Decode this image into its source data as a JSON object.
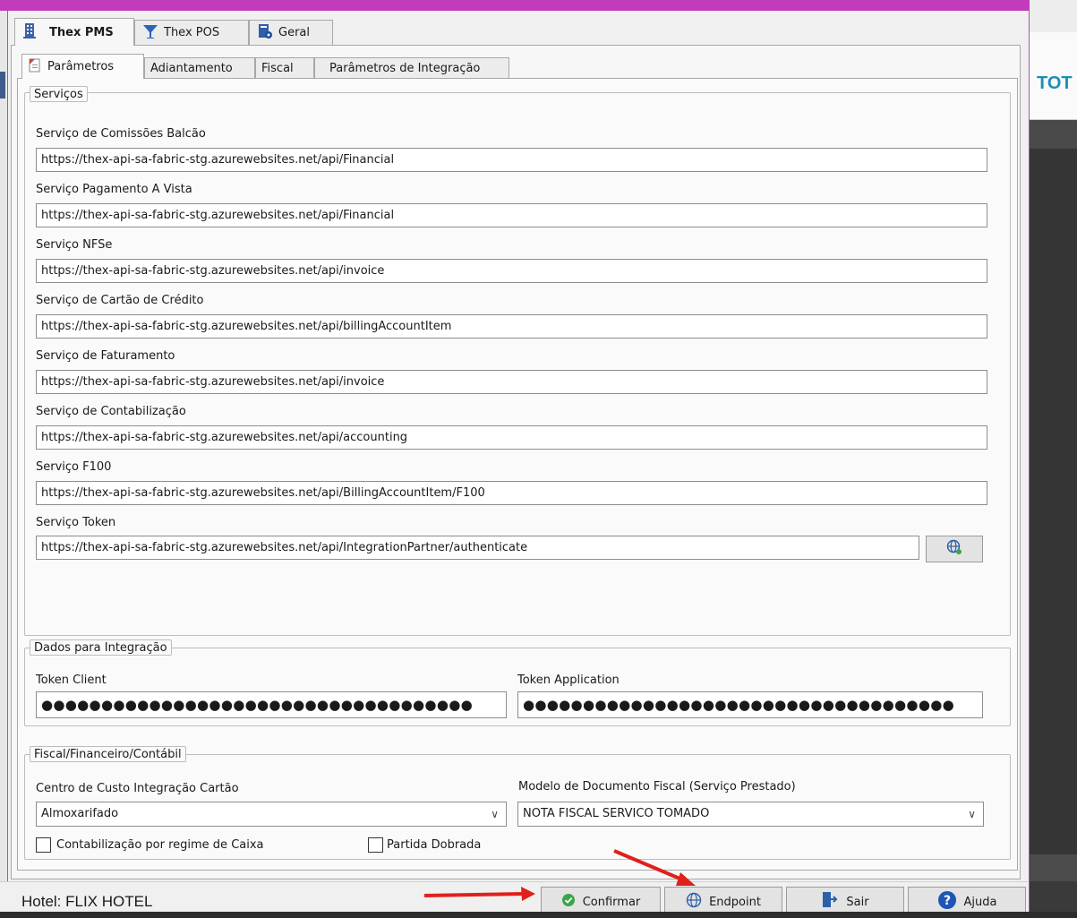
{
  "background_app": {
    "logo_text": "TOT"
  },
  "tabs": [
    {
      "label": "Thex PMS",
      "active": true,
      "icon": "building-icon"
    },
    {
      "label": "Thex POS",
      "active": false,
      "icon": "cocktail-glass-icon"
    },
    {
      "label": "Geral",
      "active": false,
      "icon": "document-settings-icon"
    }
  ],
  "subtabs": [
    {
      "label": "Parâmetros",
      "active": true,
      "icon": "document-icon"
    },
    {
      "label": "Adiantamento",
      "active": false
    },
    {
      "label": "Fiscal",
      "active": false
    },
    {
      "label": "Parâmetros de Integração",
      "active": false
    }
  ],
  "servicos": {
    "legend": "Serviços",
    "fields": [
      {
        "label": "Serviço de Comissões Balcão",
        "value": "https://thex-api-sa-fabric-stg.azurewebsites.net/api/Financial"
      },
      {
        "label": "Serviço Pagamento A Vista",
        "value": "https://thex-api-sa-fabric-stg.azurewebsites.net/api/Financial"
      },
      {
        "label": "Serviço NFSe",
        "value": "https://thex-api-sa-fabric-stg.azurewebsites.net/api/invoice"
      },
      {
        "label": "Serviço de Cartão de Crédito",
        "value": "https://thex-api-sa-fabric-stg.azurewebsites.net/api/billingAccountItem"
      },
      {
        "label": "Serviço de Faturamento",
        "value": "https://thex-api-sa-fabric-stg.azurewebsites.net/api/invoice"
      },
      {
        "label": "Serviço de Contabilização",
        "value": "https://thex-api-sa-fabric-stg.azurewebsites.net/api/accounting"
      },
      {
        "label": "Serviço F100",
        "value": "https://thex-api-sa-fabric-stg.azurewebsites.net/api/BillingAccountItem/F100"
      },
      {
        "label": "Serviço Token",
        "value": "https://thex-api-sa-fabric-stg.azurewebsites.net/api/IntegrationPartner/authenticate"
      }
    ]
  },
  "integracao": {
    "legend": "Dados para Integração",
    "token_client_label": "Token Client",
    "token_client_value": "●●●●●●●●●●●●●●●●●●●●●●●●●●●●●●●●●●●●",
    "token_application_label": "Token Application",
    "token_application_value": "●●●●●●●●●●●●●●●●●●●●●●●●●●●●●●●●●●●●"
  },
  "fiscal": {
    "legend": "Fiscal/Financeiro/Contábil",
    "centro_custo_label": "Centro de Custo Integração Cartão",
    "centro_custo_value": "Almoxarifado",
    "modelo_doc_label": "Modelo de Documento Fiscal (Serviço Prestado)",
    "modelo_doc_value": "NOTA FISCAL SERVICO TOMADO",
    "checkbox_caixa_label": "Contabilização por regime de Caixa",
    "checkbox_caixa_checked": false,
    "checkbox_partida_label": "Partida Dobrada",
    "checkbox_partida_checked": false
  },
  "footer": {
    "hotel_text": "Hotel: FLIX HOTEL",
    "buttons": {
      "confirmar": "Confirmar",
      "endpoint": "Endpoint",
      "sair": "Sair",
      "ajuda": "Ajuda"
    }
  },
  "colors": {
    "title_bar": "#c03cbc",
    "annotation_arrow": "#e0201c",
    "confirm_icon": "#3aa54a",
    "help_icon": "#1e56b4",
    "logo": "#1e8fb4"
  }
}
